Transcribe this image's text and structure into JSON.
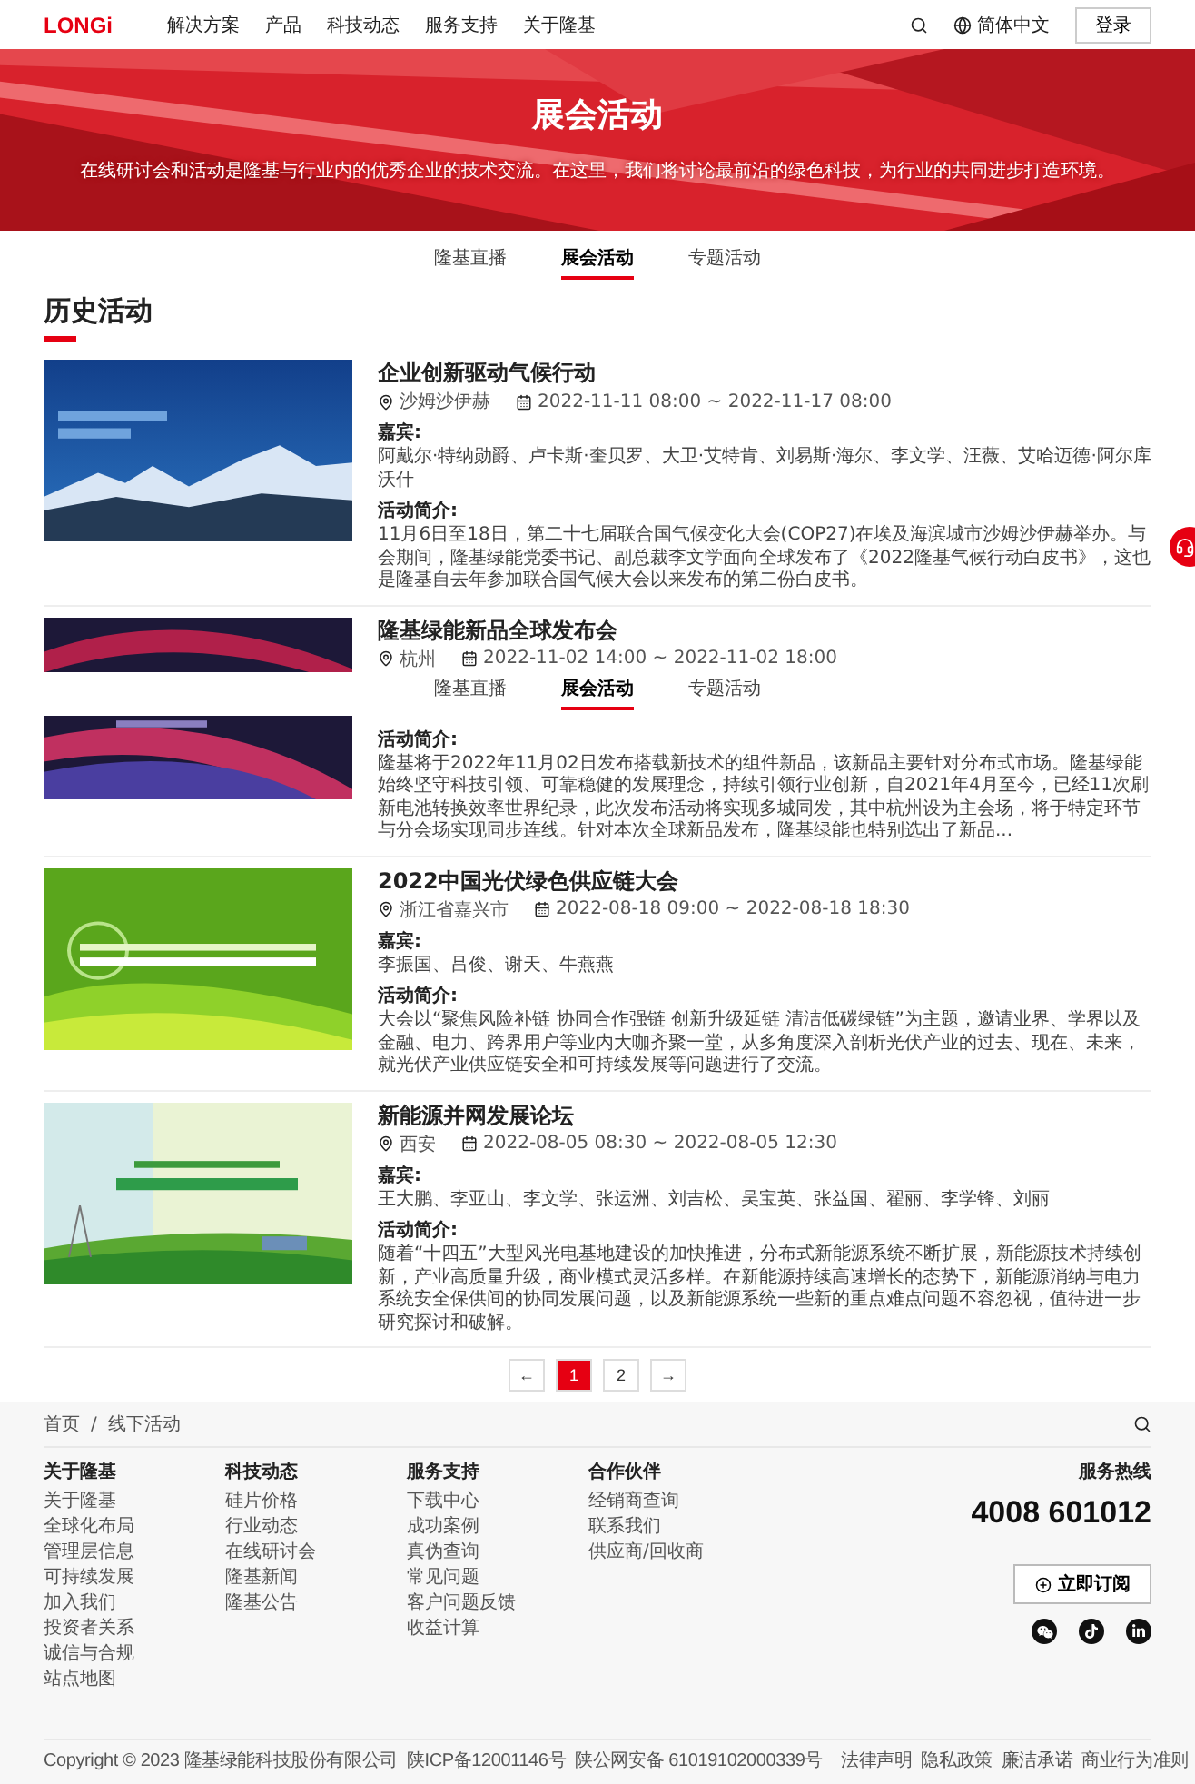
{
  "header": {
    "logo": "LONGi",
    "nav": [
      "解决方案",
      "产品",
      "科技动态",
      "服务支持",
      "关于隆基"
    ],
    "language": "简体中文",
    "login": "登录"
  },
  "hero": {
    "title": "展会活动",
    "subtitle": "在线研讨会和活动是隆基与行业内的优秀企业的技术交流。在这里，我们将讨论最前沿的绿色科技，为行业的共同进步打造环境。"
  },
  "tabs": [
    {
      "label": "隆基直播",
      "selected": false
    },
    {
      "label": "展会活动",
      "selected": true
    },
    {
      "label": "专题活动",
      "selected": false
    }
  ],
  "section_title": "历史活动",
  "events": [
    {
      "title": "企业创新驱动气候行动",
      "location": "沙姆沙伊赫",
      "time": "2022-11-11 08:00 ~ 2022-11-17 08:00",
      "guests_label": "嘉宾:",
      "guests": "阿戴尔·特纳勋爵、卢卡斯·奎贝罗、大卫·艾特肯、刘易斯·海尔、李文学、汪薇、艾哈迈德·阿尔库沃什",
      "intro_label": "活动简介:",
      "intro": "11月6日至18日，第二十七届联合国气候变化大会(COP27)在埃及海滨城市沙姆沙伊赫举办。与会期间，隆基绿能党委书记、副总裁李文学面向全球发布了《2022隆基气候行动白皮书》，这也是隆基自去年参加联合国气候大会以来发布的第二份白皮书。"
    },
    {
      "title": "隆基绿能新品全球发布会",
      "location": "杭州",
      "time": "2022-11-02 14:00 ~ 2022-11-02 18:00",
      "sticky_tabs": [
        {
          "label": "隆基直播",
          "selected": false
        },
        {
          "label": "展会活动",
          "selected": true
        },
        {
          "label": "专题活动",
          "selected": false
        }
      ],
      "intro_label": "活动简介:",
      "intro": "隆基将于2022年11月02日发布搭载新技术的组件新品，该新品主要针对分布式市场。隆基绿能始终坚守科技引领、可靠稳健的发展理念，持续引领行业创新，自2021年4月至今，已经11次刷新电池转换效率世界纪录，此次发布活动将实现多城同发，其中杭州设为主会场，将于特定环节与分会场实现同步连线。针对本次全球新品发布，隆基绿能也特别选出了新品..."
    },
    {
      "title": "2022中国光伏绿色供应链大会",
      "location": "浙江省嘉兴市",
      "time": "2022-08-18 09:00 ~ 2022-08-18 18:30",
      "guests_label": "嘉宾:",
      "guests": "李振国、吕俊、谢天、牛燕燕",
      "intro_label": "活动简介:",
      "intro": "大会以“聚焦风险补链 协同合作强链 创新升级延链 清洁低碳绿链”为主题，邀请业界、学界以及金融、电力、跨界用户等业内大咖齐聚一堂，从多角度深入剖析光伏产业的过去、现在、未来，就光伏产业供应链安全和可持续发展等问题进行了交流。"
    },
    {
      "title": "新能源并网发展论坛",
      "location": "西安",
      "time": "2022-08-05 08:30 ~ 2022-08-05 12:30",
      "guests_label": "嘉宾:",
      "guests": "王大鹏、李亚山、李文学、张运洲、刘吉松、吴宝英、张益国、翟丽、李学锋、刘丽",
      "intro_label": "活动简介:",
      "intro": "随着“十四五”大型风光电基地建设的加快推进，分布式新能源系统不断扩展，新能源技术持续创新，产业高质量升级，商业模式灵活多样。在新能源持续高速增长的态势下，新能源消纳与电力系统安全保供间的协同发展问题，以及新能源系统一些新的重点难点问题不容忽视，值待进一步研究探讨和破解。"
    }
  ],
  "pagination": {
    "prev": "←",
    "pages": [
      {
        "label": "1",
        "selected": true
      },
      {
        "label": "2",
        "selected": false
      }
    ],
    "next": "→"
  },
  "footer": {
    "breadcrumb": [
      "首页",
      "线下活动"
    ],
    "separator": "/",
    "columns": [
      {
        "heading": "关于隆基",
        "links": [
          "关于隆基",
          "全球化布局",
          "管理层信息",
          "可持续发展",
          "加入我们",
          "投资者关系",
          "诚信与合规",
          "站点地图"
        ]
      },
      {
        "heading": "科技动态",
        "links": [
          "硅片价格",
          "行业动态",
          "在线研讨会",
          "隆基新闻",
          "隆基公告"
        ]
      },
      {
        "heading": "服务支持",
        "links": [
          "下载中心",
          "成功案例",
          "真伪查询",
          "常见问题",
          "客户问题反馈",
          "收益计算"
        ]
      },
      {
        "heading": "合作伙伴",
        "links": [
          "经销商查询",
          "联系我们",
          "供应商/回收商"
        ]
      }
    ],
    "hotline_label": "服务热线",
    "hotline": "4008 601012",
    "subscribe": "立即订阅",
    "copyright": "Copyright © 2023 隆基绿能科技股份有限公司",
    "icp": "陕ICP备12001146号",
    "police": "陕公网安备 61019102000339号",
    "legal_links": [
      "法律声明",
      "隐私政策",
      "廉洁承诺",
      "商业行为准则"
    ]
  }
}
